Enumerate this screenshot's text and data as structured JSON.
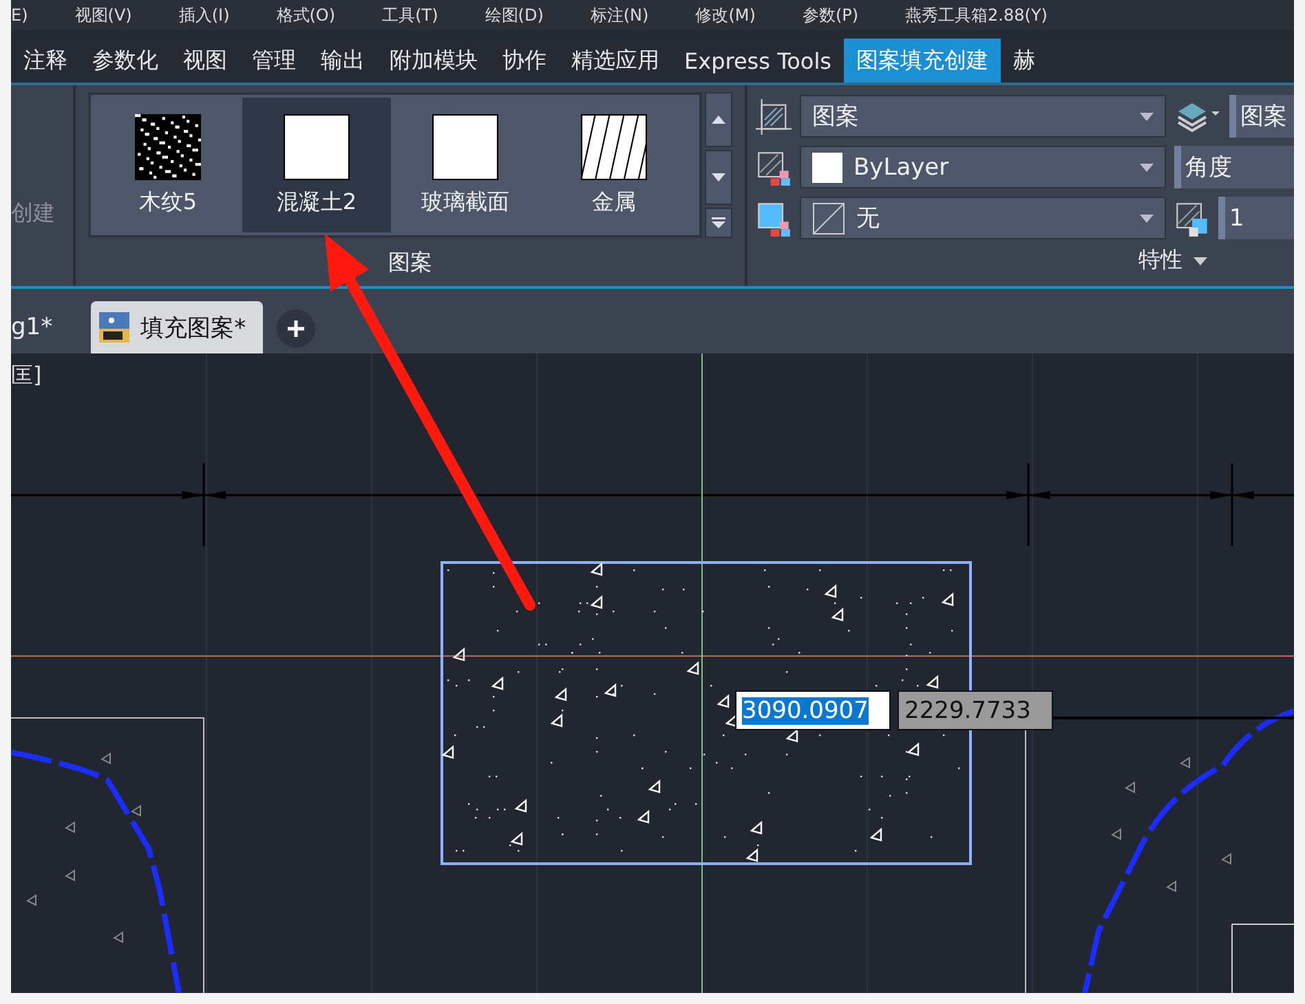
{
  "menu_bar": {
    "items": [
      "E)",
      "视图(V)",
      "插入(I)",
      "格式(O)",
      "工具(T)",
      "绘图(D)",
      "标注(N)",
      "修改(M)",
      "参数(P)",
      "燕秀工具箱2.88(Y)"
    ]
  },
  "ribbon_tabs": [
    {
      "label": "注释",
      "selected": false
    },
    {
      "label": "参数化",
      "selected": false
    },
    {
      "label": "视图",
      "selected": false
    },
    {
      "label": "管理",
      "selected": false
    },
    {
      "label": "输出",
      "selected": false
    },
    {
      "label": "附加模块",
      "selected": false
    },
    {
      "label": "协作",
      "selected": false
    },
    {
      "label": "精选应用",
      "selected": false
    },
    {
      "label": "Express Tools",
      "selected": false
    },
    {
      "label": "图案填充创建",
      "selected": true
    },
    {
      "label": "赫",
      "selected": false
    }
  ],
  "ribbon": {
    "left_panel_label": "创建",
    "pattern_panel": {
      "title": "图案",
      "patterns": [
        {
          "label": "木纹5",
          "kind": "wood",
          "selected": false
        },
        {
          "label": "混凝土2",
          "kind": "solid",
          "selected": true
        },
        {
          "label": "玻璃截面",
          "kind": "solid",
          "selected": false
        },
        {
          "label": "金属",
          "kind": "diagonal",
          "selected": false
        }
      ]
    },
    "properties_panel": {
      "title": "特性",
      "pattern_type": "图案",
      "hatch_color": "ByLayer",
      "background": "无",
      "layer_field": "图案",
      "angle_label": "角度",
      "scale": "1"
    }
  },
  "doc_tabs": [
    {
      "label": "g1*",
      "selected": false
    },
    {
      "label": "填充图案*",
      "selected": true
    }
  ],
  "canvas": {
    "viewport_label": "匡]",
    "coordinate_inputs": [
      "3090.0907",
      "2229.7733"
    ]
  }
}
